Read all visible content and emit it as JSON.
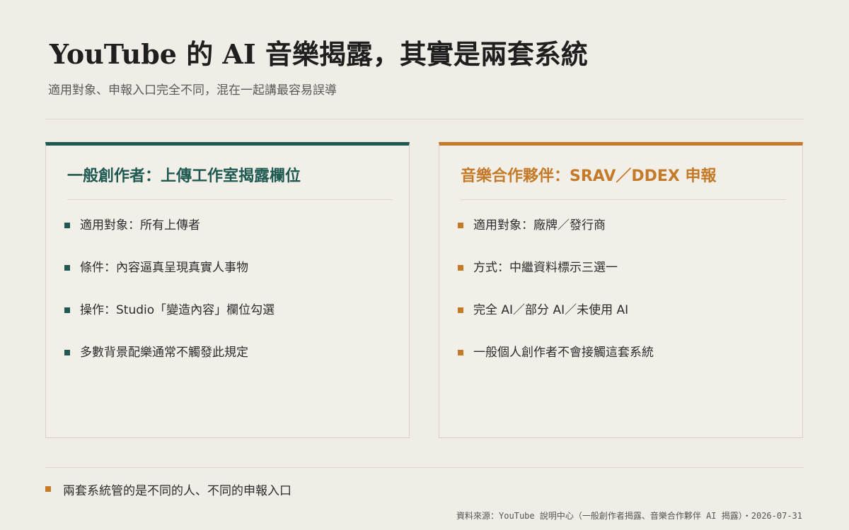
{
  "header": {
    "title": "YouTube 的 AI 音樂揭露，其實是兩套系統",
    "subtitle": "適用對象、申報入口完全不同，混在一起講最容易誤導"
  },
  "cards": [
    {
      "title": "一般創作者：上傳工作室揭露欄位",
      "accent_color": "#1f5a52",
      "items": [
        "適用對象：所有上傳者",
        "條件：內容逼真呈現真實人事物",
        "操作：Studio「變造內容」欄位勾選",
        "多數背景配樂通常不觸發此規定"
      ]
    },
    {
      "title": "音樂合作夥伴：SRAV／DDEX 申報",
      "accent_color": "#c47a28",
      "items": [
        "適用對象：廠牌／發行商",
        "方式：中繼資料標示三選一",
        "完全 AI／部分 AI／未使用 AI",
        "一般個人創作者不會接觸這套系統"
      ]
    }
  ],
  "footer": {
    "summary": "兩套系統管的是不同的人、不同的申報入口",
    "source": "資料來源：YouTube 說明中心（一般創作者揭露、音樂合作夥伴 AI 揭露）・2026-07-31"
  },
  "colors": {
    "background": "#f0ede6",
    "teal": "#1f5a52",
    "orange": "#c47a28"
  }
}
